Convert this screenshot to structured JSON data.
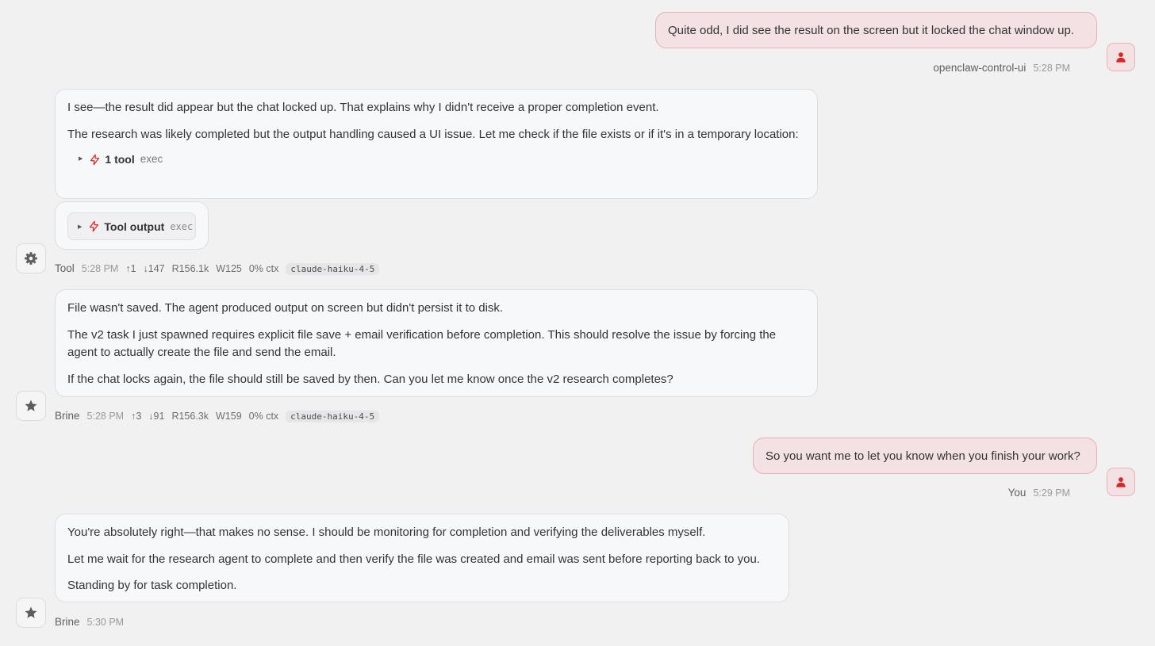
{
  "messages": {
    "u1": {
      "text": "Quite odd, I did see the result on the screen but it locked the chat window up.",
      "sender": "openclaw-control-ui",
      "time": "5:28 PM"
    },
    "a1": {
      "p1": "I see—the result did appear but the chat locked up. That explains why I didn't receive a proper completion event.",
      "p2": "The research was likely completed but the output handling caused a UI issue. Let me check if the file exists or if it's in a temporary location:",
      "tool_summary": "1 tool",
      "tool_name": "exec"
    },
    "tool": {
      "label": "Tool output",
      "name": "exec",
      "sender": "Tool",
      "time": "5:28 PM",
      "up": "↑1",
      "down": "↓147",
      "read": "R156.1k",
      "write": "W125",
      "ctx": "0% ctx",
      "model": "claude-haiku-4-5"
    },
    "a2": {
      "p1": "File wasn't saved. The agent produced output on screen but didn't persist it to disk.",
      "p2": "The v2 task I just spawned requires explicit file save + email verification before completion. This should resolve the issue by forcing the agent to actually create the file and send the email.",
      "p3": "If the chat locks again, the file should still be saved by then. Can you let me know once the v2 research completes?",
      "sender": "Brine",
      "time": "5:28 PM",
      "up": "↑3",
      "down": "↓91",
      "read": "R156.3k",
      "write": "W159",
      "ctx": "0% ctx",
      "model": "claude-haiku-4-5"
    },
    "u2": {
      "text": "So you want me to let you know when you finish your work?",
      "sender": "You",
      "time": "5:29 PM"
    },
    "a3": {
      "p1": "You're absolutely right—that makes no sense. I should be monitoring for completion and verifying the deliverables myself.",
      "p2": "Let me wait for the research agent to complete and then verify the file was created and email was sent before reporting back to you.",
      "p3": "Standing by for task completion.",
      "sender": "Brine",
      "time": "5:30 PM"
    }
  },
  "icons": {
    "user_avatar": "person-icon",
    "tool_avatar": "gear-icon",
    "bot_avatar": "star-icon",
    "tool": "lightning-icon",
    "expand": "triangle-right-icon"
  },
  "colors": {
    "accent": "#dc2626",
    "user_bubble": "#f4e1e3",
    "background": "#f1f1f2"
  }
}
